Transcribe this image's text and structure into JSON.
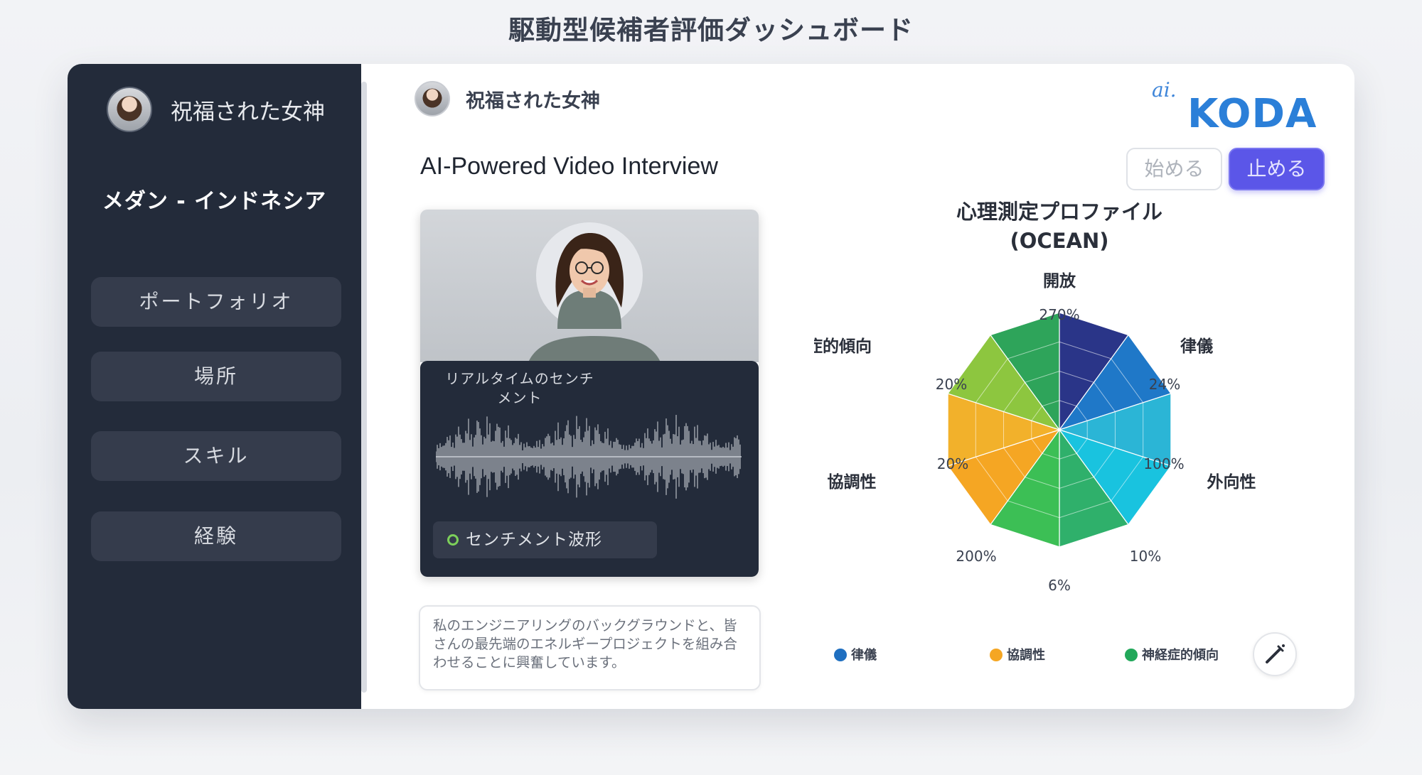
{
  "page": {
    "title": "駆動型候補者評価ダッシュボード"
  },
  "sidebar": {
    "user_name": "祝福された女神",
    "location": "メダン - インドネシア",
    "items": [
      {
        "label": "ポートフォリオ"
      },
      {
        "label": "場所"
      },
      {
        "label": "スキル"
      },
      {
        "label": "経験"
      }
    ]
  },
  "header": {
    "user_name": "祝福された女神",
    "logo_prefix": "ai.",
    "logo_name": "KODA"
  },
  "interview": {
    "title": "AI-Powered Video Interview",
    "start_label": "始める",
    "stop_label": "止める",
    "sentiment_title": "リアルタイムのセンチメント",
    "wave_label": "センチメント波形",
    "transcript": "私のエンジニアリングのバックグラウンドと、皆さんの最先端のエネルギープロジェクトを組み合わせることに興奮しています。"
  },
  "chart_data": {
    "type": "radar",
    "title": "心理測定プロファイル",
    "subtitle": "(OCEAN)",
    "axes": [
      "開放",
      "律儀",
      "外向性",
      "協調性",
      "神経症的傾向"
    ],
    "value_labels": [
      "270%",
      "24%",
      "100%",
      "10%",
      "6%",
      "200%",
      "20%",
      "20%"
    ],
    "segment_colors": [
      "#2a3588",
      "#1f78c8",
      "#2bb5d6",
      "#19c3df",
      "#2fb06b",
      "#3cbf55",
      "#f5a623",
      "#f2b12b",
      "#8dc63f",
      "#2ea45a"
    ],
    "legend": [
      {
        "name": "律儀",
        "color": "#1f6fc0"
      },
      {
        "name": "協調性",
        "color": "#f5a623"
      },
      {
        "name": "神経症的傾向",
        "color": "#22a85a"
      }
    ]
  },
  "icons": {
    "tool": "wand-icon"
  }
}
